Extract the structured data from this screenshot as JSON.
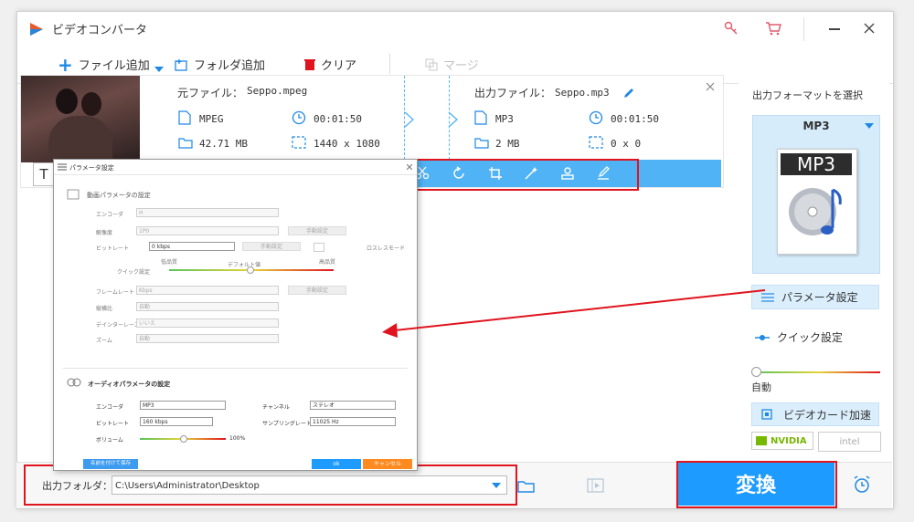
{
  "window": {
    "title": "ビデオコンバータ"
  },
  "toolbar": {
    "add_file": "ファイル追加",
    "add_folder": "フォルダ追加",
    "clear": "クリア",
    "merge": "マージ"
  },
  "file": {
    "source_label": "元ファイル：",
    "source_name": "Seppo.mpeg",
    "source_format": "MPEG",
    "source_duration": "00:01:50",
    "source_size": "42.71 MB",
    "source_resolution": "1440 x 1080",
    "output_label": "出力ファイル：",
    "output_name": "Seppo.mp3",
    "output_format": "MP3",
    "output_duration": "00:01:50",
    "output_size": "2 MB",
    "output_resolution": "0 x 0",
    "thumb_letter": "T"
  },
  "sidebar": {
    "select_format": "出力フォーマットを選択",
    "format": "MP3",
    "format_badge": "MP3",
    "param_settings": "パラメータ設定",
    "quick_settings": "クイック設定",
    "auto": "自動",
    "gpu_accel": "ビデオカード加速",
    "nvidia": "NVIDIA",
    "intel": "intel"
  },
  "bottom": {
    "output_folder_label": "出力フォルダ：",
    "output_path": "C:\\Users\\Administrator\\Desktop",
    "convert": "変換"
  },
  "dialog": {
    "title": "パラメータ設定",
    "video_section": "動画パラメータの設定",
    "encoder": "エンコーダ",
    "encoder_value": "H",
    "resolution": "解像度",
    "resolution_value": "1P0",
    "manual1": "手動設定",
    "bitrate": "ビットレート",
    "bitrate_value": "0 kbps",
    "manual2": "手動設定",
    "lossless": "ロスレスモード",
    "quick": "クイック設定",
    "low_quality": "低品質",
    "default_value": "デフォルト値",
    "high_quality": "高品質",
    "framerate": "フレームレート",
    "framerate_value": "Kbps",
    "manual3": "手動設定",
    "aspect": "縦横比",
    "aspect_value": "自動",
    "deinterlace": "デインターレース",
    "deinterlace_value": "いいえ",
    "zoom": "ズーム",
    "zoom_value": "自動",
    "audio_section": "オーディオパラメータの設定",
    "a_encoder": "エンコーダ",
    "a_encoder_value": "MP3",
    "a_channel": "チャンネル",
    "a_channel_value": "ステレオ",
    "a_bitrate": "ビットレート",
    "a_bitrate_value": "160 kbps",
    "a_samplerate": "サンプリングレート",
    "a_samplerate_value": "11025 Hz",
    "a_volume": "ボリューム",
    "a_volume_value": "100%",
    "save_as": "名前を付けて保存",
    "ok": "ok",
    "cancel": "キャンセル"
  },
  "colors": {
    "accent": "#1e9bff",
    "highlight": "#e0141e"
  }
}
